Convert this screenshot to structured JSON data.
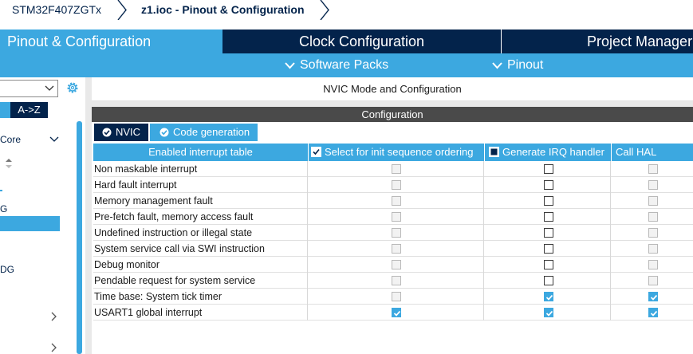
{
  "breadcrumb": {
    "chip": "STM32F407ZGTx",
    "file": "z1.ioc - Pinout & Configuration"
  },
  "top_tabs": [
    {
      "label": "Pinout & Configuration",
      "active": true
    },
    {
      "label": "Clock Configuration",
      "active": false
    },
    {
      "label": "Project Manager",
      "active": false
    }
  ],
  "sub_menu": [
    {
      "label": "Software Packs",
      "icon": "chevron-down-icon"
    },
    {
      "label": "Pinout",
      "icon": "chevron-down-icon"
    }
  ],
  "left_panel": {
    "sort_label": "A->Z",
    "category_label": "Core",
    "items": [
      "G",
      "DG"
    ]
  },
  "main": {
    "title": "NVIC Mode and Configuration",
    "section_header": "Configuration",
    "tabs": [
      {
        "label": "NVIC",
        "icon": "check-circle-icon"
      },
      {
        "label": "Code generation",
        "icon": "check-circle-icon",
        "active": true
      }
    ]
  },
  "table": {
    "columns": [
      "Enabled interrupt table",
      "Select for init sequence ordering",
      "Generate IRQ handler",
      "Call HAL handler"
    ],
    "header_checks": [
      true,
      false,
      false
    ],
    "rows": [
      {
        "name": "Non maskable interrupt",
        "init": "disabled",
        "irq": "unchecked",
        "hal": "disabled"
      },
      {
        "name": "Hard fault interrupt",
        "init": "disabled",
        "irq": "unchecked",
        "hal": "disabled"
      },
      {
        "name": "Memory management fault",
        "init": "disabled",
        "irq": "unchecked",
        "hal": "disabled"
      },
      {
        "name": "Pre-fetch fault, memory access fault",
        "init": "disabled",
        "irq": "unchecked",
        "hal": "disabled"
      },
      {
        "name": "Undefined instruction or illegal state",
        "init": "disabled",
        "irq": "unchecked",
        "hal": "disabled"
      },
      {
        "name": "System service call via SWI instruction",
        "init": "disabled",
        "irq": "unchecked",
        "hal": "disabled"
      },
      {
        "name": "Debug monitor",
        "init": "disabled",
        "irq": "unchecked",
        "hal": "disabled"
      },
      {
        "name": "Pendable request for system service",
        "init": "disabled",
        "irq": "unchecked",
        "hal": "disabled"
      },
      {
        "name": "Time base: System tick timer",
        "init": "disabled",
        "irq": "checked",
        "hal": "checked"
      },
      {
        "name": "USART1 global interrupt",
        "init": "checked",
        "irq": "checked",
        "hal": "checked"
      }
    ]
  },
  "colors": {
    "navy": "#03234b",
    "accent": "#3ca8e0",
    "header_dark": "#4a4a4a"
  }
}
